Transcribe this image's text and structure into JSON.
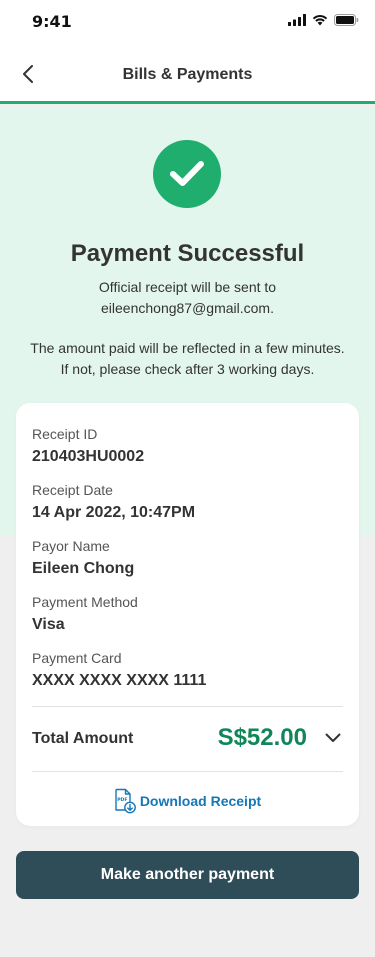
{
  "status_bar": {
    "time": "9:41"
  },
  "header": {
    "title": "Bills & Payments"
  },
  "result": {
    "title": "Payment Successful",
    "receipt_note_line1": "Official receipt will be sent to",
    "receipt_note_line2": "eileenchong87@gmail.com.",
    "info_line1": "The amount paid will be reflected in a few minutes.",
    "info_line2": "If not, please check after 3 working days."
  },
  "receipt": {
    "fields": [
      {
        "label": "Receipt ID",
        "value": "210403HU0002"
      },
      {
        "label": "Receipt Date",
        "value": "14 Apr 2022, 10:47PM"
      },
      {
        "label": "Payor Name",
        "value": "Eileen Chong"
      },
      {
        "label": "Payment Method",
        "value": "Visa"
      },
      {
        "label": "Payment Card",
        "value": "XXXX XXXX XXXX 1111"
      }
    ],
    "total_label": "Total Amount",
    "total_value": "S$52.00",
    "download_label": "Download Receipt",
    "download_icon_text": "PDF"
  },
  "actions": {
    "make_another_label": "Make another payment"
  },
  "colors": {
    "accent_green": "#1fae6e",
    "amount_green": "#11865a",
    "link_blue": "#1577b5",
    "button_dark": "#2e4d58",
    "hero_bg": "#e3f6ed"
  },
  "icons": [
    "back-arrow-icon",
    "check-icon",
    "chevron-down-icon",
    "pdf-download-icon",
    "signal-icon",
    "wifi-icon",
    "battery-icon"
  ]
}
